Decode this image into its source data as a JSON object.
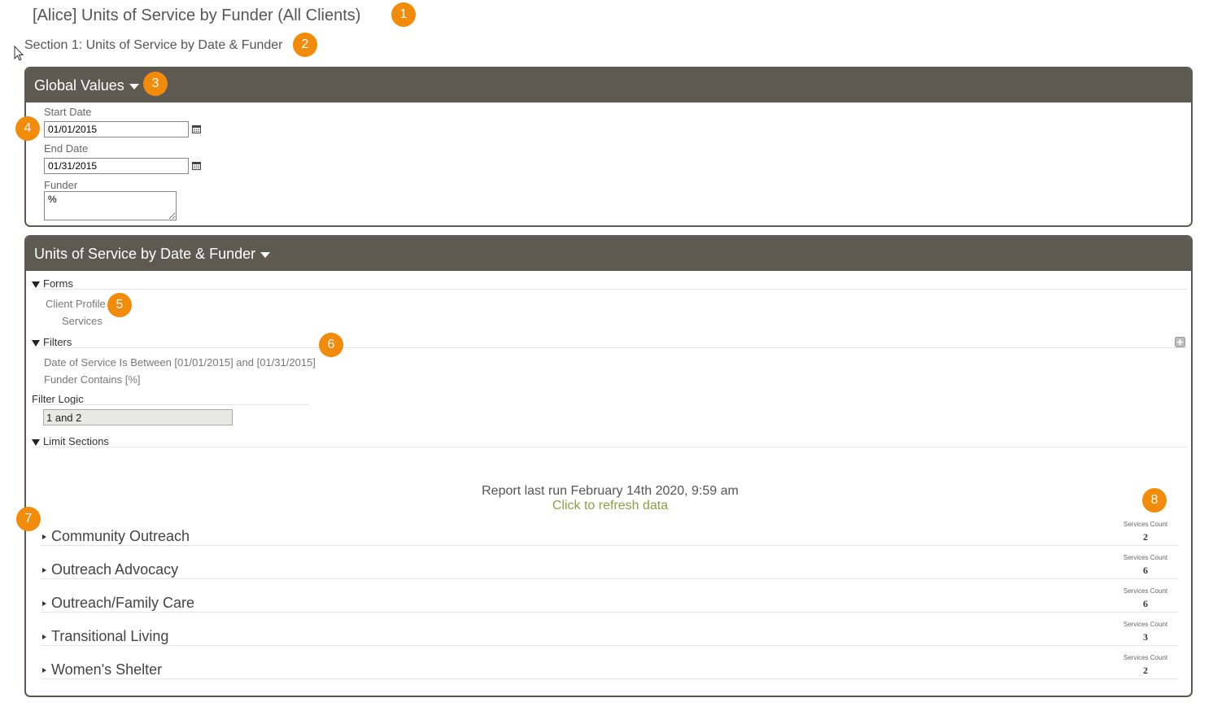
{
  "header": {
    "report_title": "[Alice] Units of Service by Funder (All Clients)",
    "section_title": "Section 1: Units of Service by Date & Funder"
  },
  "global_values": {
    "title": "Global Values",
    "start_date_label": "Start Date",
    "start_date_value": "01/01/2015",
    "end_date_label": "End Date",
    "end_date_value": "01/31/2015",
    "funder_label": "Funder",
    "funder_value": "%"
  },
  "units_panel": {
    "title": "Units of Service by Date & Funder",
    "forms_label": "Forms",
    "forms": [
      "Client Profile",
      "Services"
    ],
    "filters_label": "Filters",
    "filters": [
      "Date of Service Is Between [01/01/2015] and [01/31/2015]",
      "Funder Contains [%]"
    ],
    "filter_logic_label": "Filter Logic",
    "filter_logic_value": "1 and 2",
    "limit_sections_label": "Limit Sections",
    "last_run_text": "Report last run February 14th 2020, 9:59 am",
    "refresh_text": "Click to refresh data",
    "groups": [
      {
        "name": "Community Outreach",
        "count_label": "Services Count",
        "count": "2"
      },
      {
        "name": "Outreach Advocacy",
        "count_label": "Services Count",
        "count": "6"
      },
      {
        "name": "Outreach/Family Care",
        "count_label": "Services Count",
        "count": "6"
      },
      {
        "name": "Transitional Living",
        "count_label": "Services Count",
        "count": "3"
      },
      {
        "name": "Women's Shelter",
        "count_label": "Services Count",
        "count": "2"
      }
    ]
  },
  "callouts": [
    "1",
    "2",
    "3",
    "4",
    "5",
    "6",
    "7",
    "8"
  ],
  "colors": {
    "panel_header": "#5e5a52",
    "callout": "#f28a0a",
    "refresh_link": "#8aa045"
  }
}
